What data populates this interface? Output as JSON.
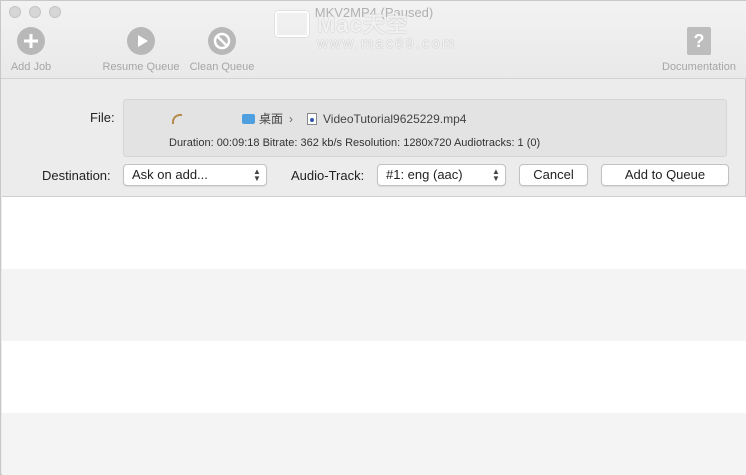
{
  "window": {
    "title": "MKV2MP4 (Paused)"
  },
  "watermark": {
    "top": "Mac天空",
    "bottom": "www.mac69.com"
  },
  "toolbar": {
    "add_job": "Add Job",
    "resume_queue": "Resume Queue",
    "clean_queue": "Clean Queue",
    "documentation": "Documentation"
  },
  "form": {
    "file_label": "File:",
    "path_folder": "桌面",
    "path_separator": "›",
    "file_name": "VideoTutorial9625229.mp4",
    "meta": "Duration: 00:09:18  Bitrate: 362 kb/s  Resolution: 1280x720  Audiotracks: 1 (0)",
    "destination_label": "Destination:",
    "destination_value": "Ask on add...",
    "audio_track_label": "Audio-Track:",
    "audio_track_value": "#1: eng (aac)",
    "cancel": "Cancel",
    "add_to_queue": "Add to Queue"
  },
  "icons": {
    "add": "plus-circle-icon",
    "resume": "play-circle-icon",
    "clean": "prohibit-circle-icon",
    "documentation": "help-document-icon",
    "folder": "folder-icon",
    "file": "file-icon"
  },
  "colors": {
    "folder_blue": "#4d9fe0",
    "toolbar_icon_gray": "#b8b8b8"
  }
}
